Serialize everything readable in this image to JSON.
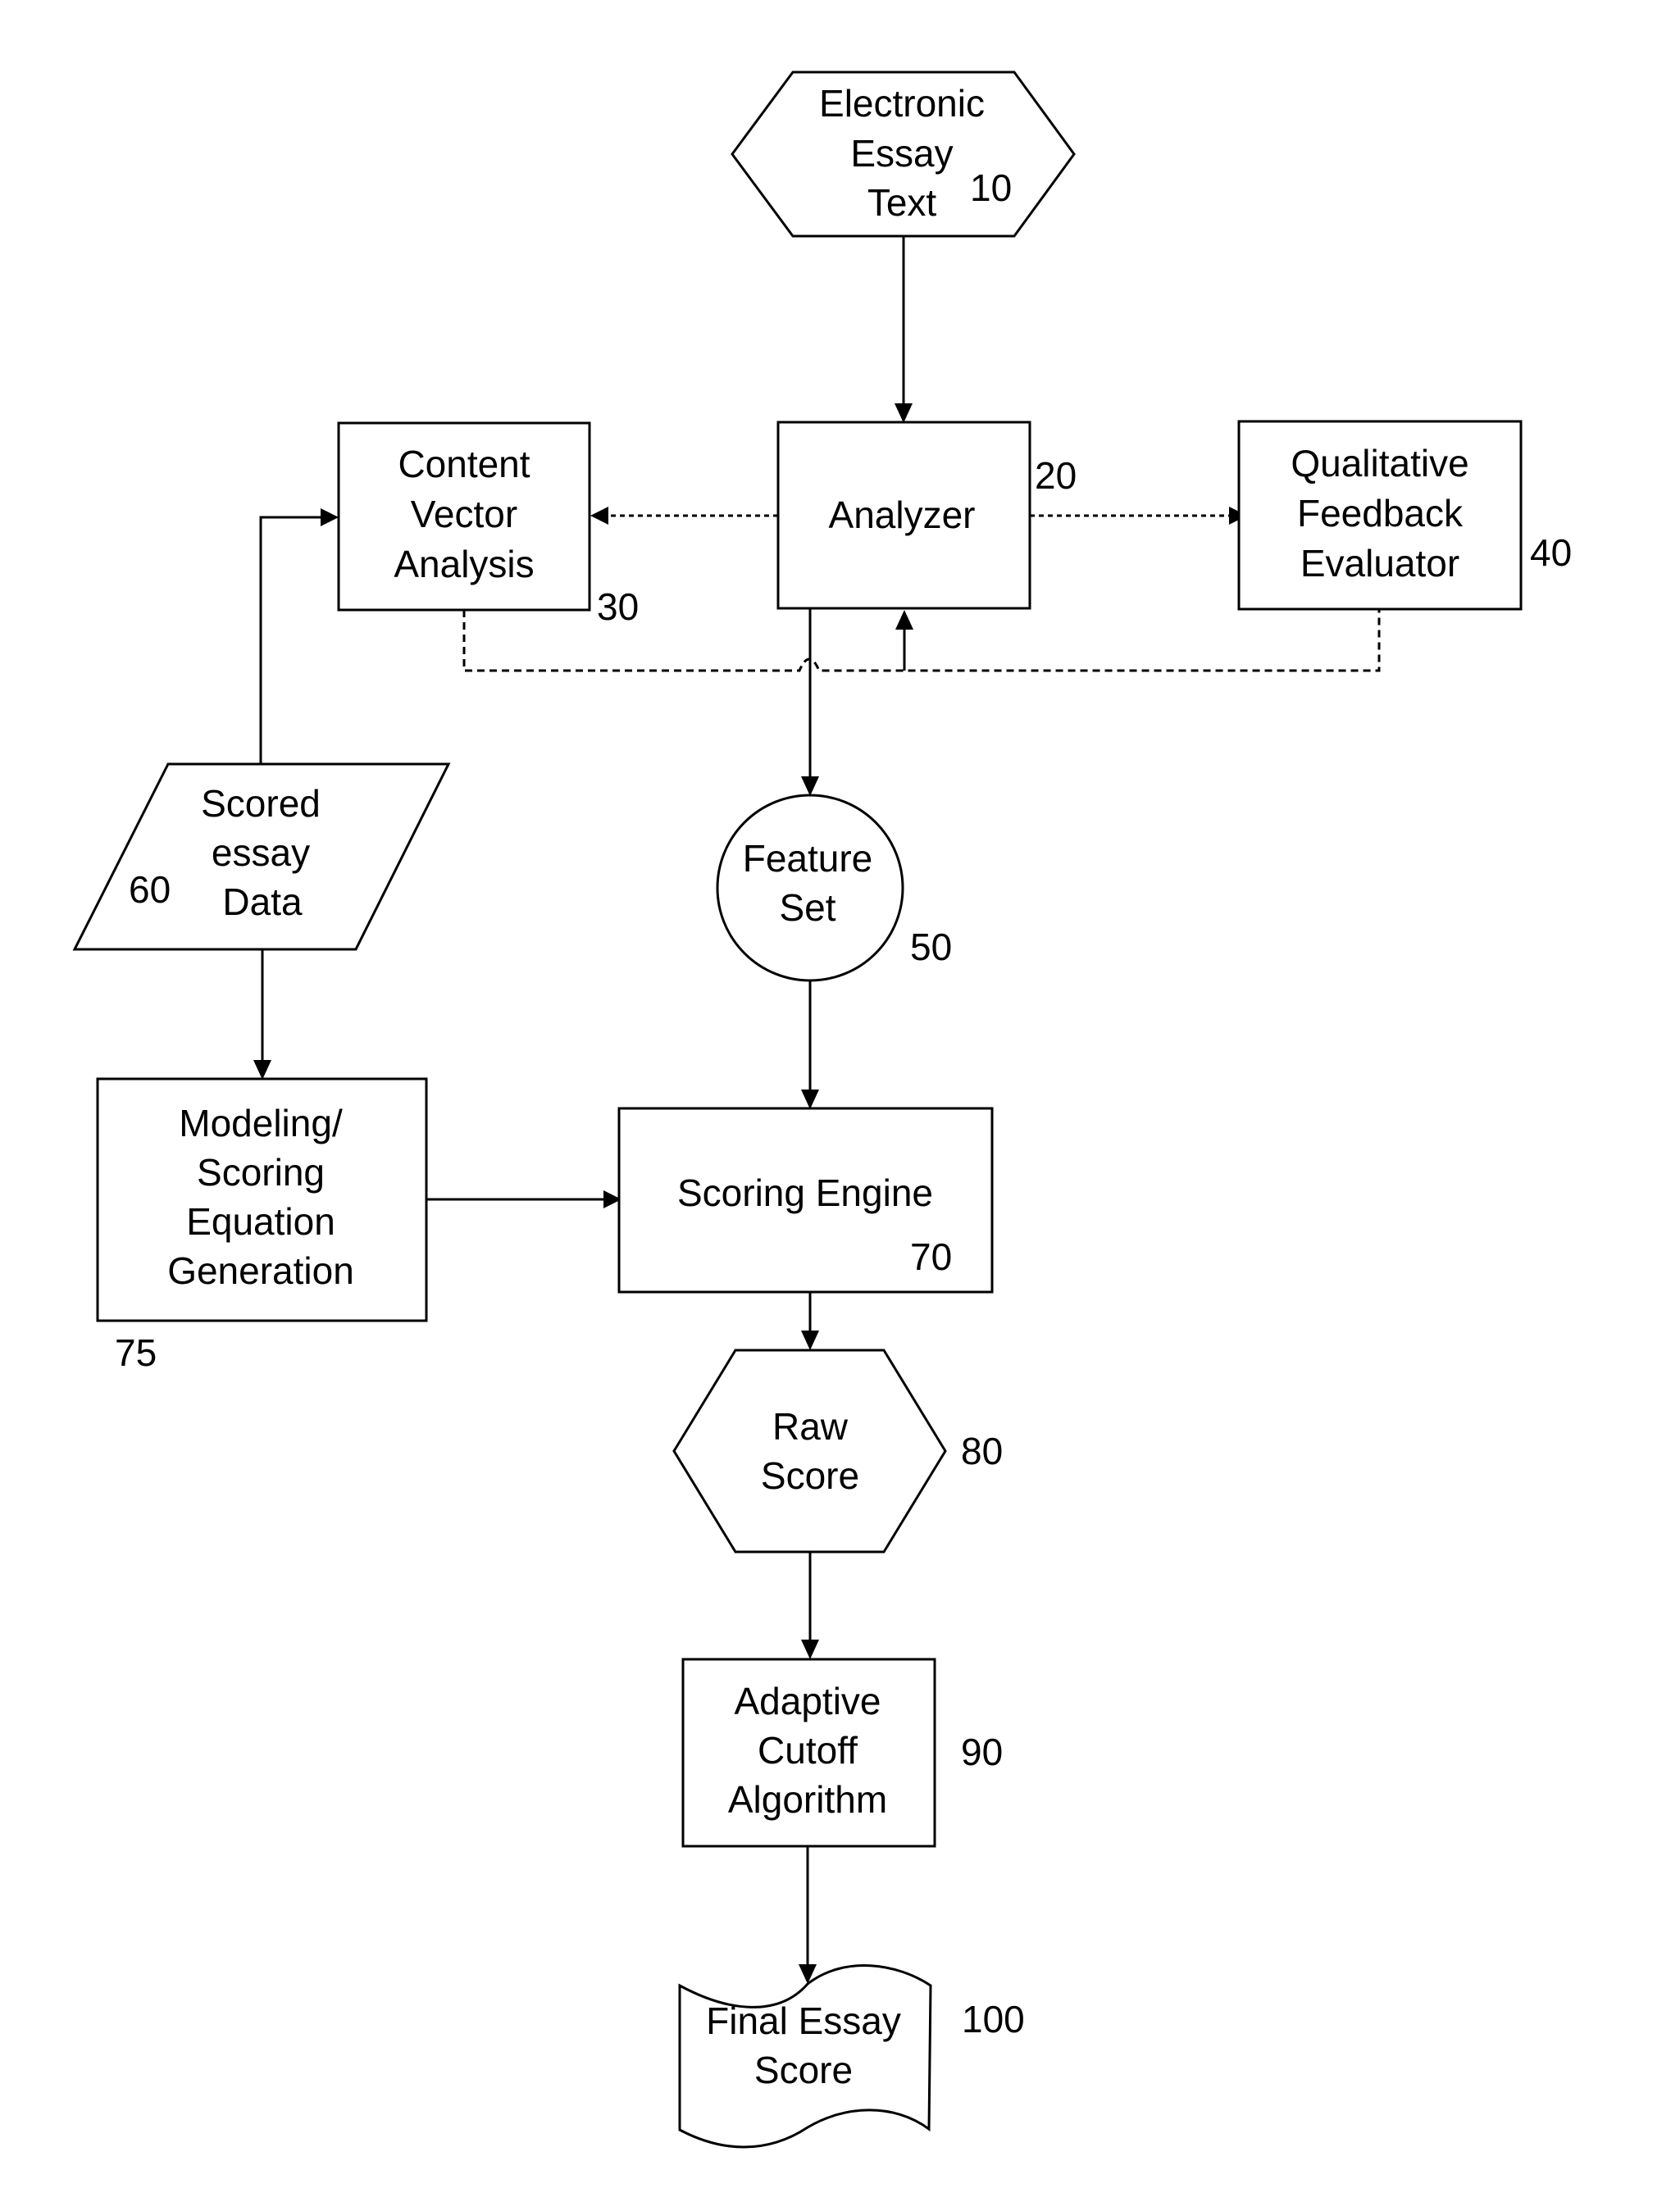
{
  "diagram": {
    "type": "flowchart",
    "nodes": {
      "essay_text": {
        "lines": [
          "Electronic",
          "Essay",
          "Text"
        ],
        "ref": "10",
        "shape": "hexagon"
      },
      "analyzer": {
        "lines": [
          "Analyzer"
        ],
        "ref": "20",
        "shape": "rectangle"
      },
      "content_vector": {
        "lines": [
          "Content",
          "Vector",
          "Analysis"
        ],
        "ref": "30",
        "shape": "rectangle"
      },
      "qualitative_feedback": {
        "lines": [
          "Qualitative",
          "Feedback",
          "Evaluator"
        ],
        "ref": "40",
        "shape": "rectangle"
      },
      "feature_set": {
        "lines": [
          "Feature",
          "Set"
        ],
        "ref": "50",
        "shape": "circle"
      },
      "scored_essay_data": {
        "lines": [
          "Scored",
          "essay",
          "Data"
        ],
        "ref": "60",
        "shape": "parallelogram"
      },
      "scoring_engine": {
        "lines": [
          "Scoring Engine"
        ],
        "ref": "70",
        "shape": "rectangle"
      },
      "modeling": {
        "lines": [
          "Modeling/",
          "Scoring",
          "Equation",
          "Generation"
        ],
        "ref": "75",
        "shape": "rectangle"
      },
      "raw_score": {
        "lines": [
          "Raw",
          "Score"
        ],
        "ref": "80",
        "shape": "hexagon"
      },
      "adaptive_cutoff": {
        "lines": [
          "Adaptive",
          "Cutoff",
          "Algorithm"
        ],
        "ref": "90",
        "shape": "rectangle"
      },
      "final_score": {
        "lines": [
          "Final Essay",
          "Score"
        ],
        "ref": "100",
        "shape": "document"
      }
    },
    "edges": [
      {
        "from": "essay_text",
        "to": "analyzer",
        "style": "solid"
      },
      {
        "from": "analyzer",
        "to": "content_vector",
        "style": "dotted"
      },
      {
        "from": "analyzer",
        "to": "qualitative_feedback",
        "style": "dotted"
      },
      {
        "from": "content_vector",
        "to": "analyzer",
        "style": "dashed"
      },
      {
        "from": "qualitative_feedback",
        "to": "analyzer",
        "style": "dashed"
      },
      {
        "from": "analyzer",
        "to": "feature_set",
        "style": "solid"
      },
      {
        "from": "scored_essay_data",
        "to": "content_vector",
        "style": "solid"
      },
      {
        "from": "scored_essay_data",
        "to": "modeling",
        "style": "solid"
      },
      {
        "from": "feature_set",
        "to": "scoring_engine",
        "style": "solid"
      },
      {
        "from": "modeling",
        "to": "scoring_engine",
        "style": "solid"
      },
      {
        "from": "scoring_engine",
        "to": "raw_score",
        "style": "solid"
      },
      {
        "from": "raw_score",
        "to": "adaptive_cutoff",
        "style": "solid"
      },
      {
        "from": "adaptive_cutoff",
        "to": "final_score",
        "style": "solid"
      }
    ]
  }
}
